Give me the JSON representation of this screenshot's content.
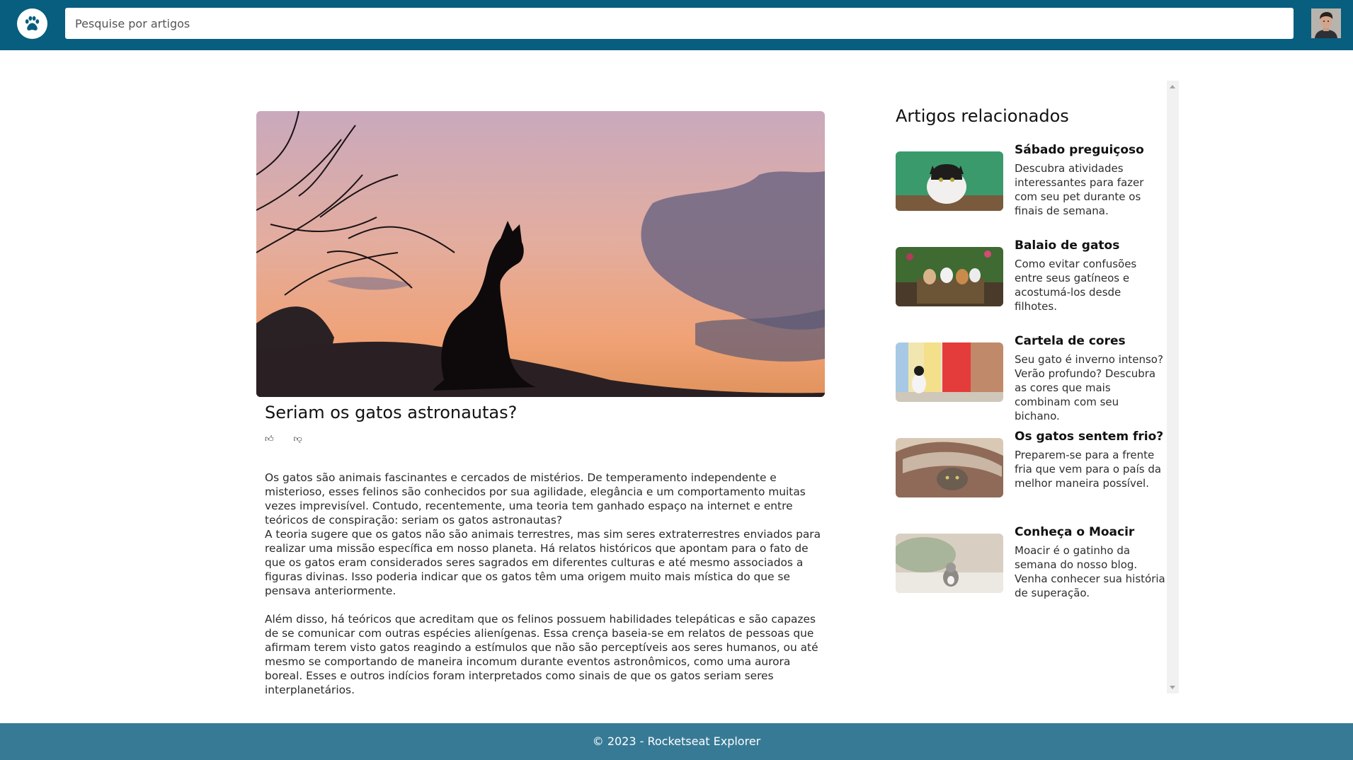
{
  "header": {
    "logo_icon": "paw-icon",
    "search_placeholder": "Pesquise por artigos",
    "avatar_icon": "user-avatar"
  },
  "article": {
    "title": "Seriam os gatos astronautas?",
    "like_icon": "thumbs-up-icon",
    "dislike_icon": "thumbs-down-icon",
    "paragraphs": [
      "Os gatos são animais fascinantes e cercados de mistérios. De temperamento independente e misterioso, esses felinos são conhecidos por sua agilidade, elegância e um comportamento muitas vezes imprevisível. Contudo, recentemente, uma teoria tem ganhado espaço na internet e entre teóricos de conspiração: seriam os gatos astronautas?",
      "A teoria sugere que os gatos não são animais terrestres, mas sim seres extraterrestres enviados para realizar uma missão específica em nosso planeta. Há relatos históricos que apontam para o fato de que os gatos eram considerados seres sagrados em diferentes culturas e até mesmo associados a figuras divinas. Isso poderia indicar que os gatos têm uma origem muito mais mística do que se pensava anteriormente.",
      "Além disso, há teóricos que acreditam que os felinos possuem habilidades telepáticas e são capazes de se comunicar com outras espécies alienígenas. Essa crença baseia-se em relatos de pessoas que afirmam terem visto gatos reagindo a estímulos que não são perceptíveis aos seres humanos, ou até mesmo se comportando de maneira incomum durante eventos astronômicos, como uma aurora boreal. Esses e outros indícios foram interpretados como sinais de que os gatos seriam seres interplanetários."
    ]
  },
  "sidebar": {
    "title": "Artigos relacionados",
    "items": [
      {
        "title": "Sábado preguiçoso",
        "desc": "Descubra atividades interessantes para fazer com seu pet durante os finais de semana."
      },
      {
        "title": "Balaio de gatos",
        "desc": "Como evitar confusões entre seus gatíneos e acostumá-los desde filhotes."
      },
      {
        "title": "Cartela de cores",
        "desc": "Seu gato é inverno intenso? Verão profundo? Descubra as cores que mais combinam com seu bichano."
      },
      {
        "title": "Os gatos sentem frio?",
        "desc": "Preparem-se para a frente fria que vem para o país da melhor maneira possível."
      },
      {
        "title": "Conheça o Moacir",
        "desc": "Moacir é o gatinho da semana do nosso blog. Venha conhecer sua história de superação."
      }
    ]
  },
  "footer": {
    "text": "© 2023 - Rocketseat Explorer"
  }
}
